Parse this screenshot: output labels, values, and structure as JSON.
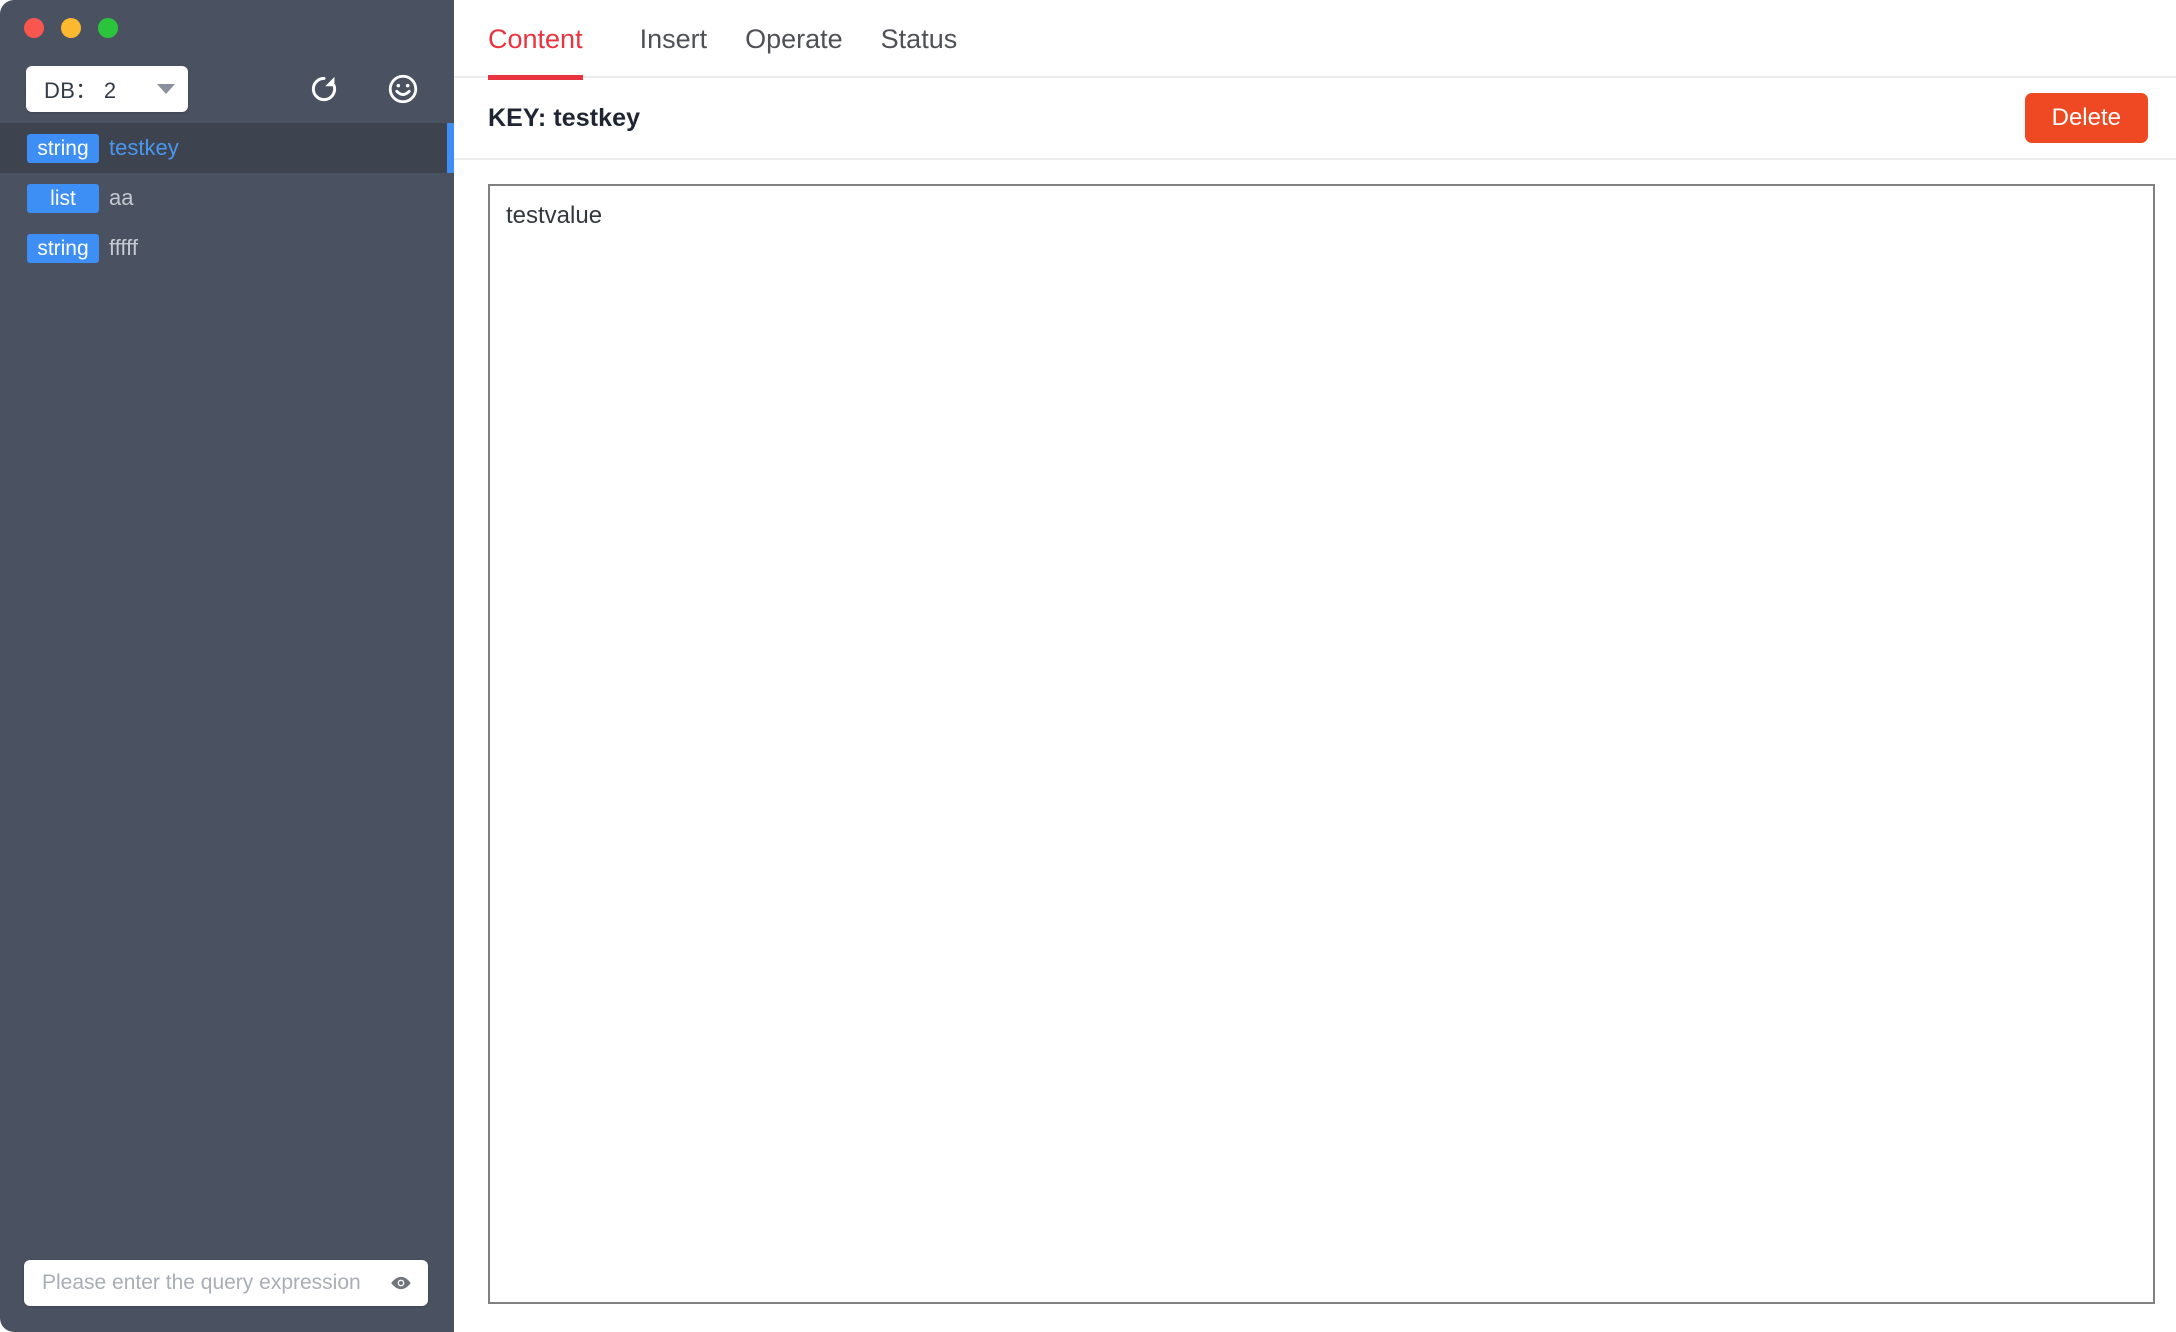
{
  "window": {
    "traffic_lights": [
      {
        "name": "close",
        "color": "#f9564f"
      },
      {
        "name": "minimize",
        "color": "#fcb930"
      },
      {
        "name": "maximize",
        "color": "#2ac53a"
      }
    ]
  },
  "sidebar": {
    "db_selector": {
      "label": "DB： 2",
      "selected": "2"
    },
    "toolbar_icons": [
      {
        "name": "refresh-icon"
      },
      {
        "name": "smiley-icon"
      }
    ],
    "keys": [
      {
        "type": "string",
        "name": "testkey",
        "selected": true
      },
      {
        "type": "list",
        "name": "aa",
        "selected": false
      },
      {
        "type": "string",
        "name": "fffff",
        "selected": false
      }
    ],
    "query": {
      "placeholder": "Please enter the query expression",
      "value": ""
    }
  },
  "main": {
    "tabs": [
      {
        "label": "Content",
        "active": true
      },
      {
        "label": "Insert",
        "active": false
      },
      {
        "label": "Operate",
        "active": false
      },
      {
        "label": "Status",
        "active": false
      }
    ],
    "key_header": {
      "title": "KEY: testkey",
      "delete_label": "Delete"
    },
    "content": {
      "value": "testvalue"
    }
  },
  "colors": {
    "sidebar_bg": "#4a5160",
    "sidebar_selected_bg": "#3d4450",
    "accent_blue": "#3d8ef5",
    "accent_red": "#e8343f",
    "delete_orange": "#ef4923"
  }
}
